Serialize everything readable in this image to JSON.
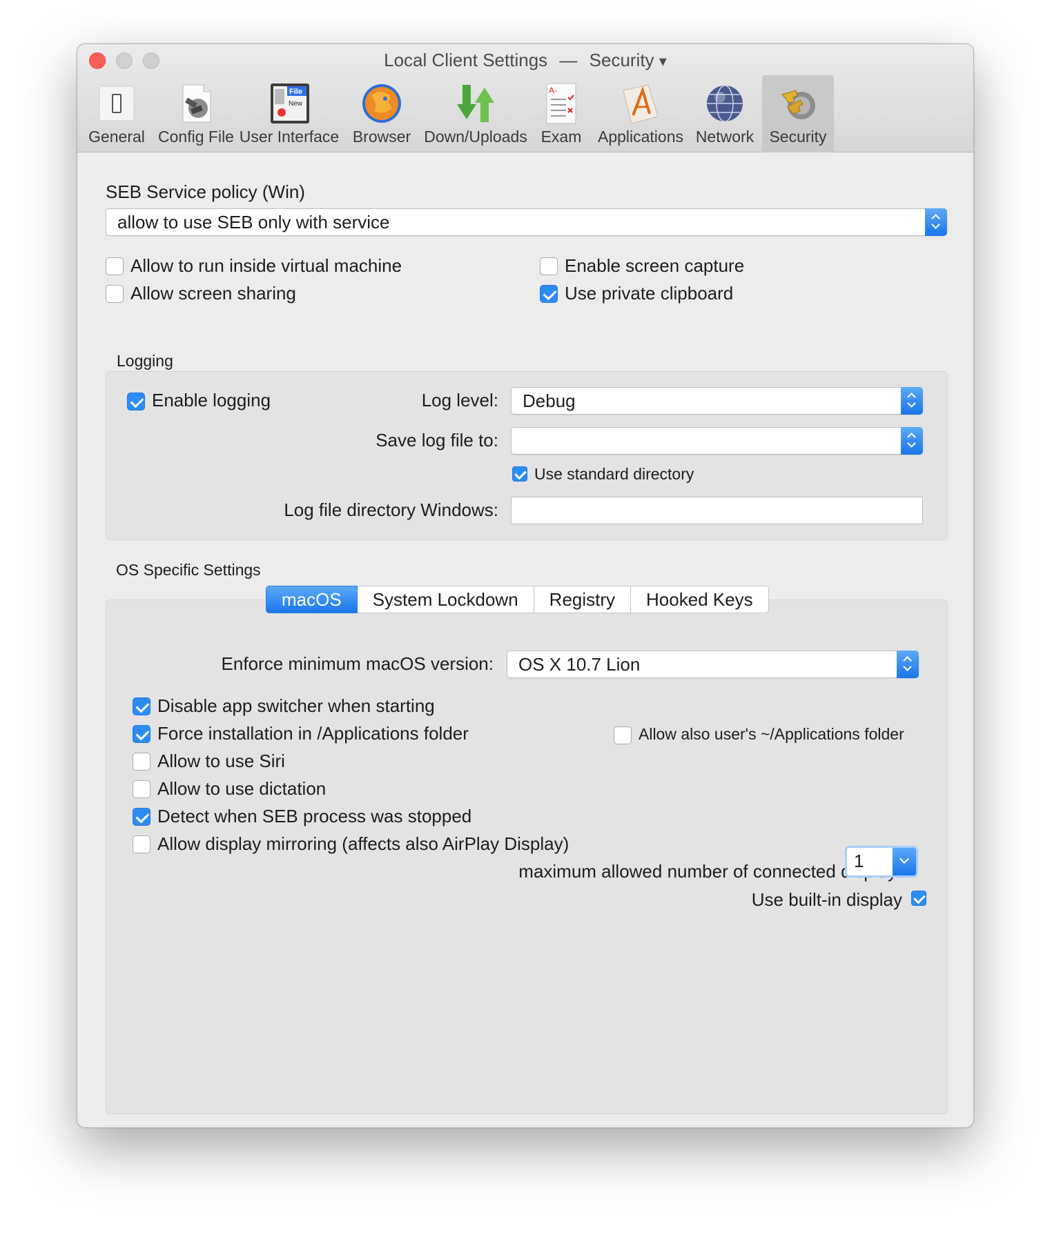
{
  "window": {
    "title": "Local Client Settings",
    "title_separator": "—",
    "title_section": "Security",
    "title_dropdown_glyph": "▾"
  },
  "toolbar": {
    "items": [
      {
        "label": "General",
        "icon": "switch-icon"
      },
      {
        "label": "Config File",
        "icon": "config-file-icon"
      },
      {
        "label": "User Interface",
        "icon": "user-interface-icon",
        "icon_text_1": "File",
        "icon_text_2": "New"
      },
      {
        "label": "Browser",
        "icon": "browser-icon"
      },
      {
        "label": "Down/Uploads",
        "icon": "down-uploads-icon"
      },
      {
        "label": "Exam",
        "icon": "exam-icon"
      },
      {
        "label": "Applications",
        "icon": "applications-icon"
      },
      {
        "label": "Network",
        "icon": "network-globe-icon"
      },
      {
        "label": "Security",
        "icon": "security-keys-icon",
        "selected": true
      }
    ]
  },
  "service_policy": {
    "label": "SEB Service policy (Win)",
    "value": "allow to use SEB only with service"
  },
  "options": {
    "vm": {
      "label": "Allow to run inside virtual machine",
      "checked": false
    },
    "screen_sharing": {
      "label": "Allow screen sharing",
      "checked": false
    },
    "screen_capture": {
      "label": "Enable screen capture",
      "checked": false
    },
    "private_clipboard": {
      "label": "Use private clipboard",
      "checked": true
    }
  },
  "logging": {
    "section_title": "Logging",
    "enable": {
      "label": "Enable logging",
      "checked": true
    },
    "log_level_label": "Log level:",
    "log_level_value": "Debug",
    "save_to_label": "Save log file to:",
    "save_to_value": "",
    "standard_dir": {
      "label": "Use standard directory",
      "checked": true
    },
    "win_dir_label": "Log file directory Windows:",
    "win_dir_value": ""
  },
  "os_specific": {
    "section_title": "OS Specific Settings",
    "tabs": [
      {
        "label": "macOS",
        "active": true
      },
      {
        "label": "System Lockdown",
        "active": false
      },
      {
        "label": "Registry",
        "active": false
      },
      {
        "label": "Hooked Keys",
        "active": false
      }
    ],
    "min_version_label": "Enforce minimum macOS version:",
    "min_version_value": "OS X 10.7 Lion",
    "checks": {
      "disable_app_switcher": {
        "label": "Disable app switcher when starting",
        "checked": true
      },
      "force_install": {
        "label": "Force installation in /Applications folder",
        "checked": true
      },
      "allow_user_apps": {
        "label": "Allow also user's ~/Applications folder",
        "checked": false
      },
      "siri": {
        "label": "Allow to use Siri",
        "checked": false
      },
      "dictation": {
        "label": "Allow to use dictation",
        "checked": false
      },
      "detect_stopped": {
        "label": "Detect when SEB process was stopped",
        "checked": true
      },
      "display_mirroring": {
        "label": "Allow display mirroring (affects also AirPlay Display)",
        "checked": false
      }
    },
    "max_displays_label": "maximum allowed number of connected displays",
    "max_displays_value": "1",
    "builtin_display": {
      "label": "Use built-in display",
      "checked": true
    }
  },
  "colors": {
    "accent": "#2c8cf4",
    "close": "#fc5f57",
    "window_bg": "#ececec",
    "group_bg": "#e3e3e3"
  }
}
